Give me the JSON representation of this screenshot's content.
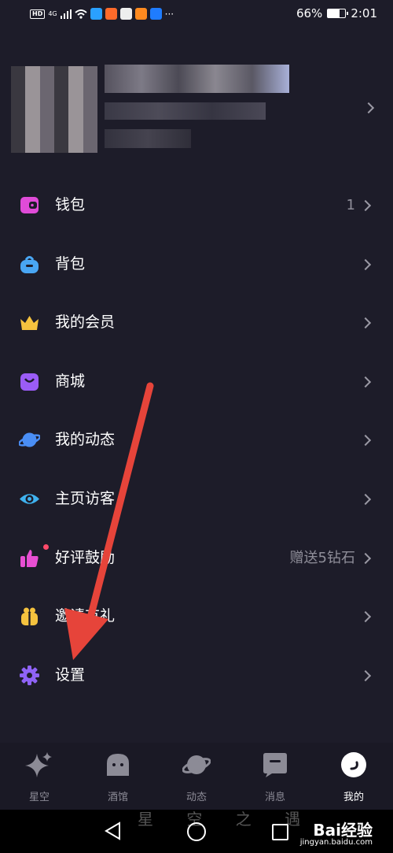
{
  "status_bar": {
    "network_tag": "HD",
    "signal_tag": "4G",
    "more": "···",
    "battery": "66%",
    "battery_level": 0.66,
    "time": "2:01"
  },
  "menu": [
    {
      "label": "钱包",
      "value": "1",
      "icon": "wallet-icon",
      "color": "#e04bd8"
    },
    {
      "label": "背包",
      "value": "",
      "icon": "backpack-icon",
      "color": "#49a6f3"
    },
    {
      "label": "我的会员",
      "value": "",
      "icon": "crown-icon",
      "color": "#f5c23e"
    },
    {
      "label": "商城",
      "value": "",
      "icon": "shopping-bag-icon",
      "color": "#9b5cf6"
    },
    {
      "label": "我的动态",
      "value": "",
      "icon": "planet-icon",
      "color": "#4a8ef5"
    },
    {
      "label": "主页访客",
      "value": "",
      "icon": "eye-icon",
      "color": "#3fb2ef"
    },
    {
      "label": "好评鼓励",
      "value": "赠送5钻石",
      "icon": "thumbs-up-icon",
      "color": "#e84fd3"
    },
    {
      "label": "邀请有礼",
      "value": "",
      "icon": "gift-icon",
      "color": "#f5c23e"
    },
    {
      "label": "设置",
      "value": "",
      "icon": "gear-icon",
      "color": "#8f63f6"
    }
  ],
  "tabs": [
    {
      "label": "星空",
      "icon": "sparkle-icon"
    },
    {
      "label": "酒馆",
      "icon": "tavern-icon"
    },
    {
      "label": "动态",
      "icon": "planet-icon"
    },
    {
      "label": "消息",
      "icon": "message-icon"
    },
    {
      "label": "我的",
      "icon": "profile-icon",
      "active": true
    }
  ],
  "nav": {
    "watermark": "星 空 之 遇",
    "baidu_logo": "Bai经验",
    "baidu_url": "jingyan.baidu.com"
  },
  "annotation_color": "#e6443a"
}
